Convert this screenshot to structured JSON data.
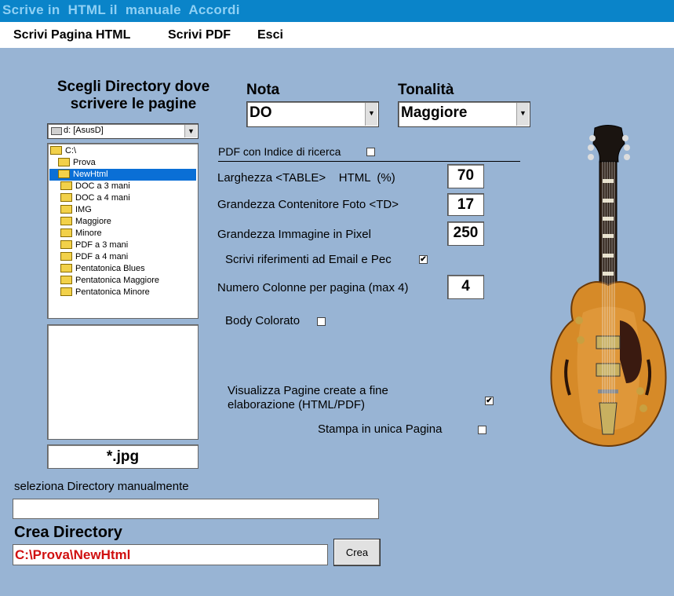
{
  "window": {
    "title": "Scrive in  HTML il  manuale  Accordi"
  },
  "menu": {
    "items": [
      "Scrivi Pagina HTML",
      "Scrivi PDF",
      "Esci"
    ]
  },
  "directory_panel": {
    "heading_line1": "Scegli Directory dove",
    "heading_line2": "scrivere le pagine",
    "drive": "d: [AsusD]",
    "dirs": [
      "C:\\",
      "Prova",
      "NewHtml",
      "DOC a 3 mani",
      "DOC a 4 mani",
      "IMG",
      "Maggiore",
      "Minore",
      "PDF a 3 mani",
      "PDF a 4 mani",
      "Pentatonica Blues",
      "Pentatonica Maggiore",
      "Pentatonica Minore"
    ],
    "selected_dir": "NewHtml",
    "file_filter": "*.jpg"
  },
  "nota": {
    "label": "Nota",
    "value": "DO"
  },
  "tonalita": {
    "label": "Tonalità",
    "value": "Maggiore"
  },
  "options": {
    "pdf_index_label": "PDF con Indice di ricerca",
    "pdf_index_checked": false,
    "table_width_label": "Larghezza <TABLE>    HTML  (%)",
    "table_width_value": "70",
    "photo_container_label": "Grandezza Contenitore Foto  <TD>",
    "photo_container_value": "17",
    "image_pixel_label": "Grandezza Immagine in Pixel",
    "image_pixel_value": "250",
    "email_refs_label": "Scrivi riferimenti ad Email e Pec",
    "email_refs_checked": true,
    "columns_label": "Numero Colonne per pagina (max 4)",
    "columns_value": "4",
    "body_colored_label": "Body Colorato",
    "body_colored_checked": false,
    "show_pages_label_line1": "Visualizza Pagine create a fine",
    "show_pages_label_line2": "elaborazione (HTML/PDF)",
    "show_pages_checked": true,
    "single_page_label": "Stampa in unica Pagina",
    "single_page_checked": false
  },
  "manual_dir": {
    "label": "seleziona Directory manualmente",
    "value": ""
  },
  "create_dir": {
    "label": "Crea Directory",
    "path": "C:\\Prova\\NewHtml",
    "button": "Crea"
  },
  "image": {
    "icon": "guitar-image"
  },
  "colors": {
    "background": "#98b4d4",
    "titlebar": "#0a84c9",
    "path_text": "#d01010",
    "selection": "#0a6fd6"
  }
}
